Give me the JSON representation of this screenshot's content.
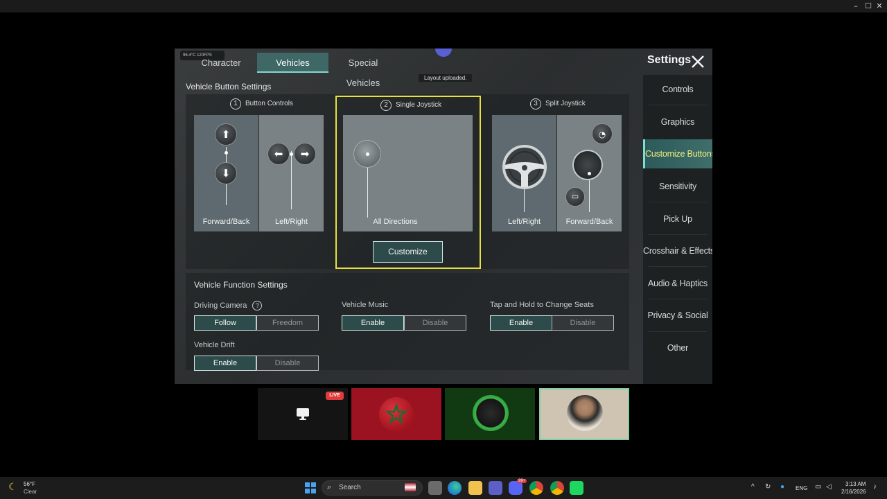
{
  "window": {
    "minimize": "–",
    "maximize": "☐",
    "close": "✕"
  },
  "game": {
    "status_chip": "96.4°C   120FPS",
    "layout_msg": "Layout uploaded.",
    "tabs": [
      {
        "label": "Character",
        "active": false
      },
      {
        "label": "Vehicles",
        "active": true
      },
      {
        "label": "Special Vehicles",
        "active": false
      }
    ],
    "settings_title": "Settings",
    "sidebar": [
      {
        "label": "Controls",
        "active": false
      },
      {
        "label": "Graphics",
        "active": false
      },
      {
        "label": "Customize Buttons",
        "active": true
      },
      {
        "label": "Sensitivity",
        "active": false
      },
      {
        "label": "Pick Up",
        "active": false
      },
      {
        "label": "Crosshair & Effects",
        "active": false
      },
      {
        "label": "Audio & Haptics",
        "active": false
      },
      {
        "label": "Privacy & Social",
        "active": false
      },
      {
        "label": "Other",
        "active": false
      }
    ],
    "vehicle_button_settings": {
      "title": "Vehicle Button Settings",
      "options": [
        {
          "num": "1",
          "title": "Button Controls",
          "left_label": "Forward/Back",
          "right_label": "Left/Right"
        },
        {
          "num": "2",
          "title": "Single Joystick",
          "pane_label": "All Directions",
          "selected": true
        },
        {
          "num": "3",
          "title": "Split Joystick",
          "left_label": "Left/Right",
          "right_label": "Forward/Back"
        }
      ],
      "customize_label": "Customize"
    },
    "vehicle_function_settings": {
      "title": "Vehicle Function Settings",
      "driving_camera": {
        "label": "Driving Camera",
        "help": "?",
        "options": [
          "Follow",
          "Freedom"
        ],
        "selected": "Follow"
      },
      "vehicle_music": {
        "label": "Vehicle Music",
        "options": [
          "Enable",
          "Disable"
        ],
        "selected": "Enable"
      },
      "change_seats": {
        "label": "Tap and Hold to Change Seats",
        "options": [
          "Enable",
          "Disable"
        ],
        "selected": "Enable"
      },
      "vehicle_drift": {
        "label": "Vehicle Drift",
        "options": [
          "Enable",
          "Disable"
        ],
        "selected": "Enable"
      }
    }
  },
  "stream": {
    "live_badge": "LIVE"
  },
  "taskbar": {
    "weather_temp": "56°F",
    "weather_desc": "Clear",
    "search_placeholder": "Search",
    "lang": "ENG",
    "time": "3:13 AM",
    "date": "2/16/2026",
    "badge_99": "99+"
  },
  "colors": {
    "accent": "#3e6766",
    "selected_outline": "#e9e23a",
    "active_side_text": "#f2f07a"
  }
}
